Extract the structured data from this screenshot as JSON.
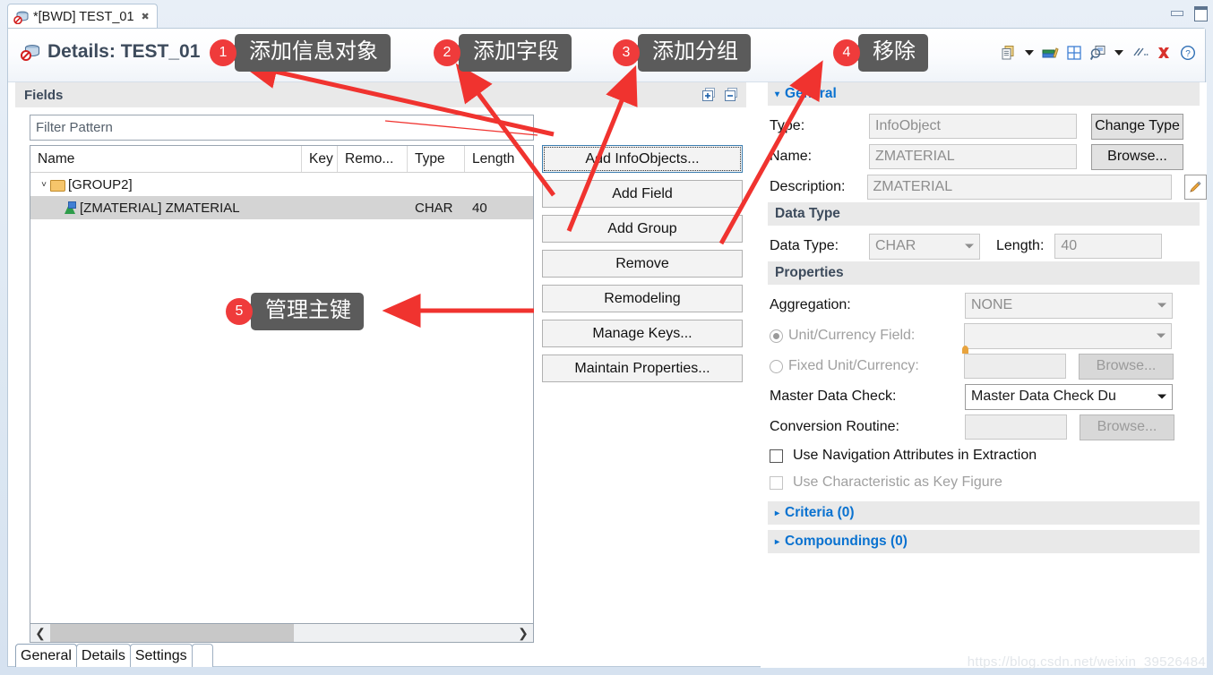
{
  "window": {
    "minimize_label": "Minimize",
    "maximize_label": "Maximize"
  },
  "editor_tab": {
    "title": "*[BWD] TEST_01",
    "close_glyph": "✖",
    "icon": "infoprovider-icon"
  },
  "header": {
    "title": "Details: TEST_01",
    "toolbar_icons": [
      "copy-icon",
      "caret-down-icon",
      "books-icon",
      "grid-icon",
      "search-doc-icon",
      "caret-down-icon",
      "lines-icon",
      "delete-x-icon",
      "help-icon"
    ]
  },
  "fields": {
    "section_title": "Fields",
    "expand_all_icon": "expand-all-icon",
    "collapse_all_icon": "collapse-all-icon",
    "filter_placeholder": "Filter Pattern",
    "filter_value": "",
    "columns": [
      "Name",
      "Key",
      "Remo...",
      "Type",
      "Length"
    ],
    "rows": [
      {
        "indent": 0,
        "twisty": "˅",
        "icon": "folder-icon",
        "name": "[GROUP2]",
        "key": "",
        "remodeling": "",
        "type": "",
        "length": "",
        "selected": false
      },
      {
        "indent": 1,
        "twisty": "",
        "icon": "infoobject-icon",
        "name": "[ZMATERIAL] ZMATERIAL",
        "key": "",
        "remodeling": "",
        "type": "CHAR",
        "length": "40",
        "selected": true
      }
    ],
    "scroll_left_glyph": "❮",
    "scroll_right_glyph": "❯"
  },
  "buttons": [
    {
      "label": "Add InfoObjects...",
      "focused": true
    },
    {
      "label": "Add Field",
      "focused": false
    },
    {
      "label": "Add Group",
      "focused": false
    },
    {
      "label": "Remove",
      "focused": false
    },
    {
      "label": "Remodeling",
      "focused": false
    },
    {
      "label": "Manage Keys...",
      "focused": false
    },
    {
      "label": "Maintain Properties...",
      "focused": false
    }
  ],
  "properties": {
    "general": {
      "title": "General",
      "type_label": "Type:",
      "type_value": "InfoObject",
      "change_type_button": "Change Type",
      "name_label": "Name:",
      "name_value": "ZMATERIAL",
      "browse_button": "Browse...",
      "description_label": "Description:",
      "description_value": "ZMATERIAL",
      "edit_icon": "pencil-icon"
    },
    "data_type": {
      "title": "Data Type",
      "data_type_label": "Data Type:",
      "data_type_value": "CHAR",
      "length_label": "Length:",
      "length_value": "40"
    },
    "props": {
      "title": "Properties",
      "aggregation_label": "Aggregation:",
      "aggregation_value": "NONE",
      "unit_currency_label": "Unit/Currency Field:",
      "unit_currency_value": "",
      "fixed_unit_label": "Fixed Unit/Currency:",
      "fixed_unit_value": "",
      "fixed_unit_browse": "Browse...",
      "master_data_check_label": "Master Data Check:",
      "master_data_check_value": "Master Data Check Du",
      "conversion_routine_label": "Conversion Routine:",
      "conversion_routine_value": "",
      "conversion_browse": "Browse...",
      "nav_attr_checkbox_label": "Use Navigation Attributes in Extraction",
      "key_figure_checkbox_label": "Use Characteristic as Key Figure"
    },
    "criteria_section": "Criteria (0)",
    "compoundings_section": "Compoundings (0)"
  },
  "bottom_tabs": [
    {
      "label": "General",
      "active": true
    },
    {
      "label": "Details",
      "active": false
    },
    {
      "label": "Settings",
      "active": false
    }
  ],
  "watermark": "https://blog.csdn.net/weixin_39526484",
  "annotations": [
    {
      "number": "1",
      "text": "添加信息对象"
    },
    {
      "number": "2",
      "text": "添加字段"
    },
    {
      "number": "3",
      "text": "添加分组"
    },
    {
      "number": "4",
      "text": "移除"
    },
    {
      "number": "5",
      "text": "管理主键"
    }
  ],
  "colors": {
    "accent_blue": "#0a72d0",
    "annotation_red": "#ef3b3b",
    "bubble_gray": "#5b5b5b",
    "selection_gray": "#d4d4d4"
  }
}
